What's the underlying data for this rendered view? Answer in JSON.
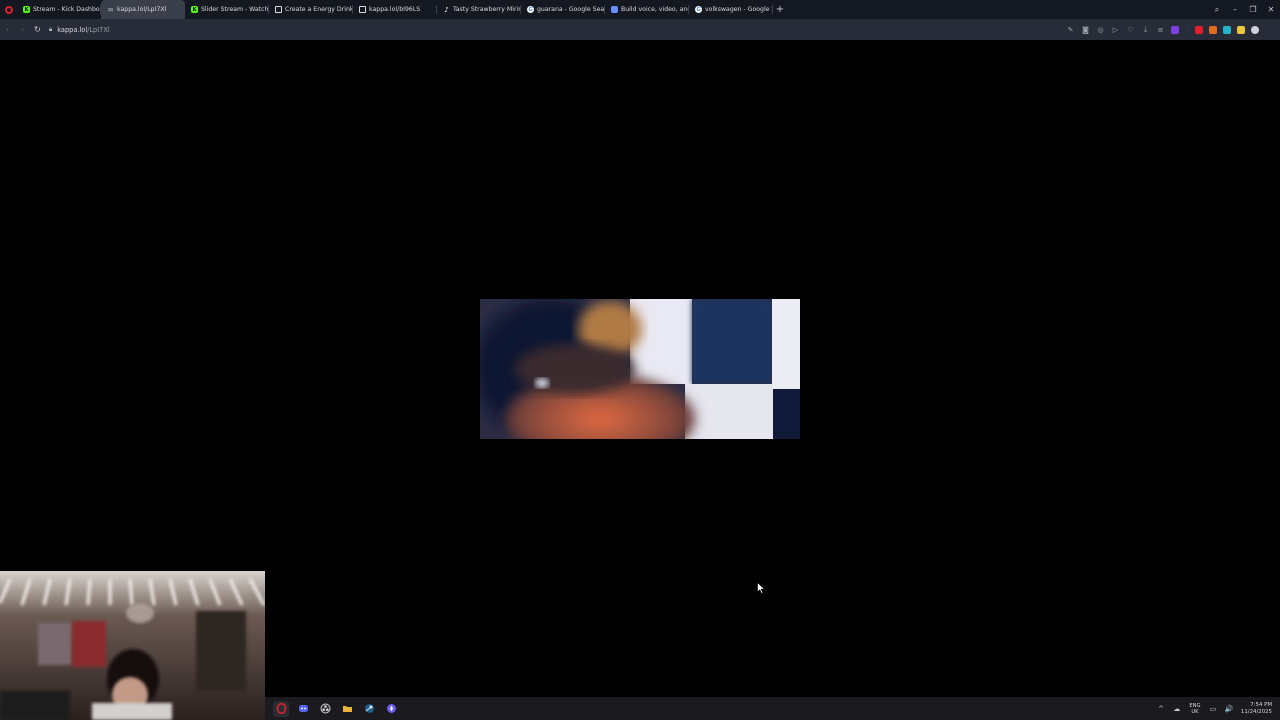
{
  "browser": {
    "tabs": [
      {
        "title": "Stream - Kick Dashboard",
        "favicon": "kick-icon",
        "color": "#53fc18",
        "active": false
      },
      {
        "title": "kappa.lol/LpI7Xl",
        "favicon": "link-icon",
        "color": "#9aa0aa",
        "active": true
      },
      {
        "title": "Slider Stream - Watch Live",
        "favicon": "kick-icon",
        "color": "#53fc18",
        "active": false
      },
      {
        "title": "Create a Energy Drinks UI",
        "favicon": "doc-icon",
        "color": "#d7d9de",
        "active": false
      },
      {
        "title": "kappa.lol/bI96LS",
        "favicon": "doc-icon",
        "color": "#d7d9de",
        "active": false
      },
      {
        "title": "Tasty Strawberry Mirinda",
        "favicon": "tiktok-icon",
        "color": "#ffffff",
        "active": false
      },
      {
        "title": "guarana - Google Search",
        "favicon": "google-icon",
        "color": "#ffffff",
        "active": false
      },
      {
        "title": "Build voice, video, and phone",
        "favicon": "app-icon",
        "color": "#6b8cff",
        "active": false
      },
      {
        "title": "volkswagen - Google Search",
        "favicon": "google-icon",
        "color": "#ffffff",
        "active": false
      }
    ],
    "new_tab_label": "+",
    "window_controls": {
      "search": "⌕",
      "minimize": "–",
      "restore": "❐",
      "close": "✕"
    },
    "address": {
      "host": "kappa.lol",
      "path": "/LpI7Xl"
    },
    "nav": {
      "back": "‹",
      "forward": "›",
      "reload": "↻"
    }
  },
  "taskbar": {
    "language": {
      "code": "ENG",
      "region": "UK"
    },
    "time": "7:54 PM",
    "date": "11/24/2025",
    "tray_icons": [
      "^",
      "☁",
      "▭",
      "🔊"
    ]
  },
  "colors": {
    "accent": "#e0202e",
    "kick_green": "#53fc18",
    "tab_active": "#3a3f4b",
    "toolbar": "#272c38"
  }
}
